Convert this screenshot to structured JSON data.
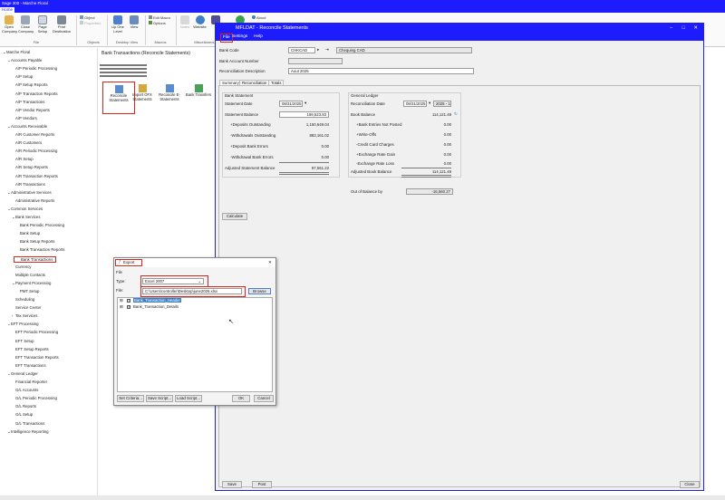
{
  "app": {
    "window_title": "Sage 300 - Marche Floral",
    "menu_home": "Home"
  },
  "ribbon": {
    "open_company": "Open Company",
    "close_company": "Close Company",
    "page_setup": "Page Setup",
    "print_destination": "Print Destination",
    "file_group": "File",
    "object_label": "Object",
    "properties_label": "Properties",
    "objects_group": "Objects",
    "up_one_level": "Up One Level",
    "view_label": "View",
    "desktop_view_group": "Desktop View",
    "edit_macro": "Edit Macro",
    "options": "Options",
    "macros_group": "Macros",
    "notes": "Notes",
    "website": "Website",
    "misc_group": "Miscellaneous",
    "about": "About"
  },
  "tree": {
    "items": [
      {
        "label": "Marche Floral",
        "level": 0
      },
      {
        "label": "Accounts Payable",
        "level": 1
      },
      {
        "label": "A/P Periodic Processing",
        "level": 2
      },
      {
        "label": "A/P Setup",
        "level": 2
      },
      {
        "label": "A/P Setup Reports",
        "level": 2
      },
      {
        "label": "A/P Transaction Reports",
        "level": 2
      },
      {
        "label": "A/P Transactions",
        "level": 2
      },
      {
        "label": "A/P Vendor Reports",
        "level": 2
      },
      {
        "label": "A/P Vendors",
        "level": 2
      },
      {
        "label": "Accounts Receivable",
        "level": 1
      },
      {
        "label": "A/R Customer Reports",
        "level": 2
      },
      {
        "label": "A/R Customers",
        "level": 2
      },
      {
        "label": "A/R Periodic Processing",
        "level": 2
      },
      {
        "label": "A/R Setup",
        "level": 2
      },
      {
        "label": "A/R Setup Reports",
        "level": 2
      },
      {
        "label": "A/R Transaction Reports",
        "level": 2
      },
      {
        "label": "A/R Transactions",
        "level": 2
      },
      {
        "label": "Administrative Services",
        "level": 1
      },
      {
        "label": "Administrative Reports",
        "level": 2
      },
      {
        "label": "Common Services",
        "level": 1
      },
      {
        "label": "Bank Services",
        "level": 2
      },
      {
        "label": "Bank Periodic Processing",
        "level": 3
      },
      {
        "label": "Bank Setup",
        "level": 3
      },
      {
        "label": "Bank Setup Reports",
        "level": 3
      },
      {
        "label": "Bank Transaction Reports",
        "level": 3
      },
      {
        "label": "Bank Transactions",
        "level": 3,
        "selected": true
      },
      {
        "label": "Currency",
        "level": 2
      },
      {
        "label": "Multiple Contacts",
        "level": 2
      },
      {
        "label": "Payment Processing",
        "level": 2
      },
      {
        "label": "PMT Setup",
        "level": 3
      },
      {
        "label": "Scheduling",
        "level": 2
      },
      {
        "label": "Service Center",
        "level": 2
      },
      {
        "label": "Tax Services",
        "level": 2
      },
      {
        "label": "EFT Processing",
        "level": 1
      },
      {
        "label": "EFT Periodic Processing",
        "level": 2
      },
      {
        "label": "EFT Setup",
        "level": 2
      },
      {
        "label": "EFT Setup Reports",
        "level": 2
      },
      {
        "label": "EFT Transaction Reports",
        "level": 2
      },
      {
        "label": "EFT Transactions",
        "level": 2
      },
      {
        "label": "General Ledger",
        "level": 1
      },
      {
        "label": "Financial Reporter",
        "level": 2
      },
      {
        "label": "G/L Accounts",
        "level": 2
      },
      {
        "label": "G/L Periodic Processing",
        "level": 2
      },
      {
        "label": "G/L Reports",
        "level": 2
      },
      {
        "label": "G/L Setup",
        "level": 2
      },
      {
        "label": "G/L Transactions",
        "level": 2
      },
      {
        "label": "Intelligence Reporting",
        "level": 1
      }
    ]
  },
  "center": {
    "title": "Bank Transactions (Reconcile Statements)",
    "icons": [
      "Reconcile Statements",
      "Import OFX Statements",
      "Reconcile E-Statements",
      "Bank Transfers"
    ]
  },
  "reconcile": {
    "title": "MFLDAT - Reconcile Statements",
    "menu": [
      "File",
      "Settings",
      "Help"
    ],
    "bank_code_label": "Bank Code",
    "bank_code": "CHKCAD",
    "bank_desc": "Chequing CAD",
    "bank_account_label": "Bank Account Number",
    "recon_desc_label": "Reconciliation Description",
    "recon_desc": "Aout 2025",
    "tabs": [
      "Summary",
      "Reconciliation",
      "Totals"
    ],
    "bank_statement_header": "Bank Statement",
    "statement_date_label": "Statement Date",
    "statement_date": "08/31/2025",
    "statement_balance_label": "Statement Balance",
    "statement_balance": "169,523.83",
    "deposits_outstanding_label": "+Deposits Outstanding",
    "deposits_outstanding": "1,150,649.04",
    "withdrawals_outstanding_label": "-Withdrawals Outstanding",
    "withdrawals_outstanding": "883,161.02",
    "deposit_bank_errors_label": "+Deposit Bank Errors",
    "deposit_bank_errors": "0.00",
    "withdrawal_bank_errors_label": "-Withdrawal Bank Errors",
    "withdrawal_bank_errors": "0.00",
    "adjusted_statement_balance_label": "Adjusted Statement Balance",
    "adjusted_statement_balance": "97,561.22",
    "gl_header": "General Ledger",
    "recon_date_label": "Reconciliation Date",
    "recon_date": "08/31/2025",
    "recon_period": "2025 - 12",
    "book_balance_label": "Book Balance",
    "book_balance": "114,121.49",
    "bank_entries_label": "+Bank Entries Not Posted",
    "bank_entries": "0.00",
    "write_offs_label": "+Write-Offs",
    "write_offs": "0.00",
    "credit_card_label": "-Credit Card Charges",
    "credit_card": "0.00",
    "exchange_gain_label": "+Exchange Rate Gain",
    "exchange_gain": "0.00",
    "exchange_loss_label": "-Exchange Rate Loss",
    "exchange_loss": "0.00",
    "adjusted_book_balance_label": "Adjusted Book Balance",
    "adjusted_book_balance": "114,121.49",
    "out_of_balance_label": "Out of Balance by",
    "out_of_balance": "-16,560.27",
    "calculate_button": "Calculate",
    "save_button": "Save",
    "post_button": "Post",
    "close_button": "Close"
  },
  "export": {
    "title": "Export",
    "file_menu": "File",
    "type_label": "Type:",
    "type_value": "Excel 2007",
    "file_label": "File:",
    "file_value": "C:\\Users\\controller\\Desktop\\june2026.xlsx",
    "browse_button": "Browse",
    "items": [
      "Bank_Transaction_Header",
      "Bank_Transaction_Details"
    ],
    "set_criteria_button": "Set Criteria...",
    "save_script_button": "Save Script...",
    "load_script_button": "Load Script...",
    "ok_button": "OK",
    "cancel_button": "Cancel"
  }
}
